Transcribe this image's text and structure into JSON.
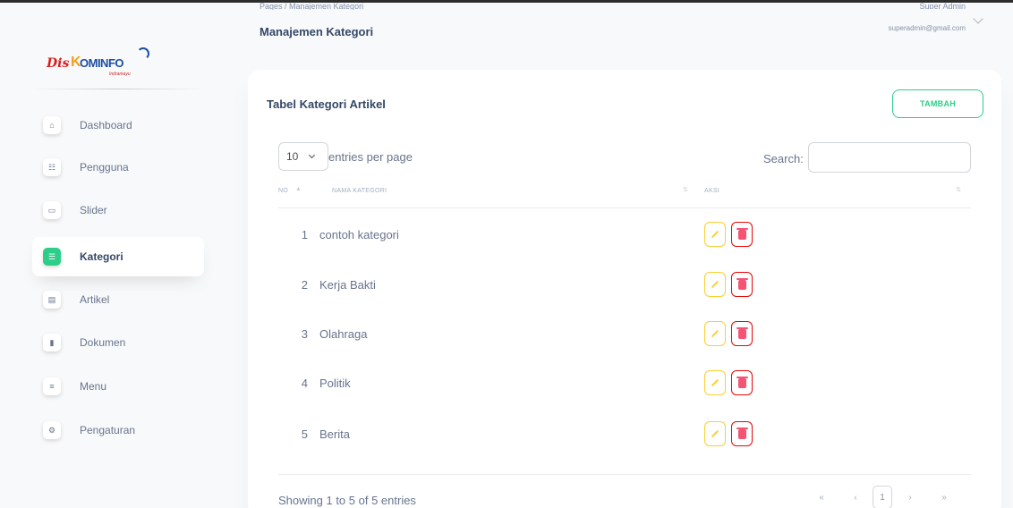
{
  "header": {
    "breadcrumb": "Pages / Manajemen Kategori",
    "title": "Manajemen Kategori",
    "user_name": "Super Admin",
    "user_email": "superadmin@gmail.com"
  },
  "sidebar": {
    "logo": {
      "part1": "Dis",
      "part2": "K",
      "part3": "OMINFO",
      "sub": "Indramayu"
    },
    "items": [
      {
        "label": "Dashboard",
        "icon": "home-icon",
        "glyph": "⌂",
        "active": false
      },
      {
        "label": "Pengguna",
        "icon": "users-icon",
        "glyph": "☷",
        "active": false
      },
      {
        "label": "Slider",
        "icon": "image-icon",
        "glyph": "▭",
        "active": false
      },
      {
        "label": "Kategori",
        "icon": "list-icon",
        "glyph": "☰",
        "active": true
      },
      {
        "label": "Artikel",
        "icon": "article-icon",
        "glyph": "▤",
        "active": false
      },
      {
        "label": "Dokumen",
        "icon": "document-icon",
        "glyph": "▮",
        "active": false
      },
      {
        "label": "Menu",
        "icon": "menu-icon",
        "glyph": "≡",
        "active": false
      },
      {
        "label": "Pengaturan",
        "icon": "gear-icon",
        "glyph": "⚙",
        "active": false
      }
    ]
  },
  "card": {
    "title": "Tabel Kategori Artikel",
    "add_label": "TAMBAH",
    "entries_value": "10",
    "entries_label": "entries per page",
    "search_label": "Search:",
    "columns": [
      "NO",
      "NAMA KATEGORI",
      "AKSI"
    ],
    "rows": [
      {
        "no": "1",
        "nama": "contoh kategori"
      },
      {
        "no": "2",
        "nama": "Kerja Bakti"
      },
      {
        "no": "3",
        "nama": "Olahraga"
      },
      {
        "no": "4",
        "nama": "Politik"
      },
      {
        "no": "5",
        "nama": "Berita"
      }
    ],
    "footer": "Showing 1 to 5 of 5 entries",
    "pagination": {
      "first": "«",
      "prev": "‹",
      "current": "1",
      "next": "›",
      "last": "»"
    }
  },
  "colors": {
    "accent": "#2dce89",
    "edit": "#fbcf33",
    "delete": "#ea0606",
    "text": "#344767",
    "muted": "#67748e"
  }
}
